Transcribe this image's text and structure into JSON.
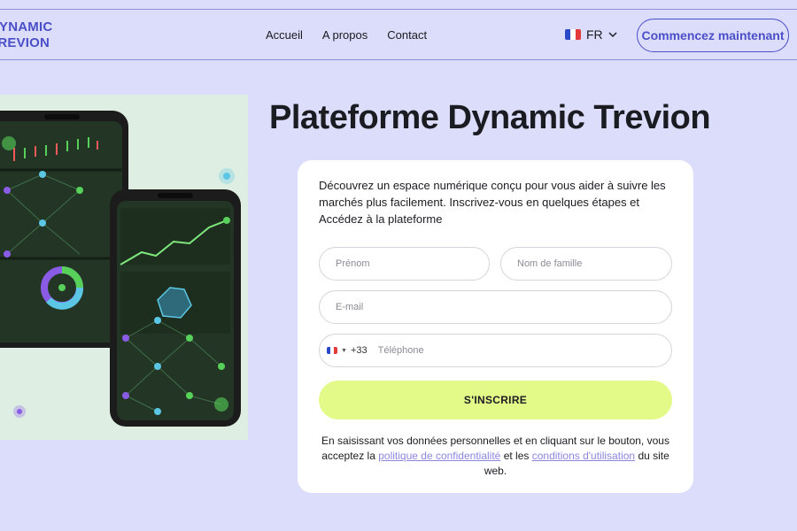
{
  "header": {
    "logo_line1": "DYNAMIC",
    "logo_line2": "TREVION",
    "nav": [
      "Accueil",
      "A propos",
      "Contact"
    ],
    "language": "FR",
    "cta_label": "Commencez maintenant"
  },
  "main": {
    "title": "Plateforme Dynamic Trevion"
  },
  "form": {
    "intro": "Découvrez un espace numérique conçu pour vous aider à suivre les marchés plus facilement. Inscrivez-vous en quelques étapes et Accédez à la plateforme",
    "first_name_placeholder": "Prénom",
    "last_name_placeholder": "Nom de famille",
    "email_placeholder": "E-mail",
    "phone_code": "+33",
    "phone_placeholder": "Téléphone",
    "submit_label": "S'INSCRIRE",
    "legal_before": "En saisissant vos données personnelles et en cliquant sur le bouton, vous acceptez la",
    "privacy_link": "politique de confidentialité",
    "legal_and": "et les",
    "terms_link": "conditions d'utilisation",
    "legal_after": "du site web."
  },
  "colors": {
    "background": "#dcdcfb",
    "brand": "#4b4fc7",
    "accent": "#e3fa88",
    "link": "#8b87e0"
  },
  "icons": [
    "france-flag-icon",
    "chevron-down-icon",
    "phone-illustration"
  ]
}
